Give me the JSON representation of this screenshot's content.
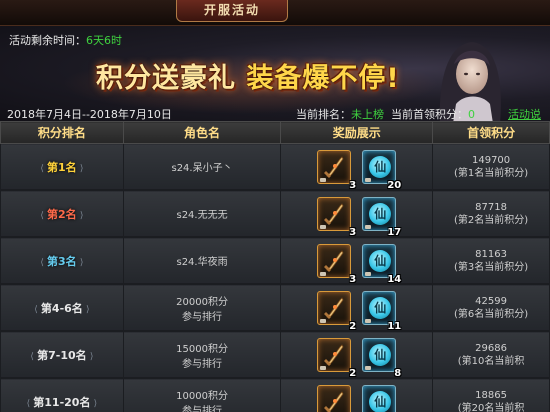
{
  "header": {
    "tab_label": "开服活动"
  },
  "banner": {
    "remaining_label": "活动剩余时间：",
    "remaining_value": "6天6时",
    "title_part1": "积分送豪礼",
    "title_part2": "装备爆不停!",
    "date_range": "2018年7月4日--2018年7月10日",
    "current_rank_label": "当前排名：",
    "current_rank_value": "未上榜",
    "current_score_label": "当前首领积分：",
    "current_score_value": "0",
    "help_link": "活动说明"
  },
  "table": {
    "headers": [
      "积分排名",
      "角色名",
      "奖励展示",
      "首领积分"
    ],
    "rows": [
      {
        "rank": "第1名",
        "name": "s24.呆小子丶",
        "qty1": "3",
        "qty2": "20",
        "score": "149700",
        "note": "(第1名当前积分)"
      },
      {
        "rank": "第2名",
        "name": "s24.无无无",
        "qty1": "3",
        "qty2": "17",
        "score": "87718",
        "note": "(第2名当前积分)"
      },
      {
        "rank": "第3名",
        "name": "s24.华夜雨",
        "qty1": "3",
        "qty2": "14",
        "score": "81163",
        "note": "(第3名当前积分)"
      },
      {
        "rank": "第4-6名",
        "name": "20000积分",
        "sub": "参与排行",
        "qty1": "2",
        "qty2": "11",
        "score": "42599",
        "note": "(第6名当前积分)"
      },
      {
        "rank": "第7-10名",
        "name": "15000积分",
        "sub": "参与排行",
        "qty1": "2",
        "qty2": "8",
        "score": "29686",
        "note": "(第10名当前积"
      },
      {
        "rank": "第11-20名",
        "name": "10000积分",
        "sub": "参与排行",
        "qty1": "",
        "qty2": "",
        "score": "18865",
        "note": "(第20名当前积"
      }
    ]
  },
  "icons": {
    "reward_item_1": "dagger-icon",
    "reward_item_2": "seal-icon",
    "seal_glyph": "仙"
  },
  "colors": {
    "accent_gold": "#ffdd88",
    "green_text": "#3fd23f",
    "rank1": "#ffd23a",
    "rank2": "#ff6a4a",
    "rank3": "#66ccee"
  }
}
